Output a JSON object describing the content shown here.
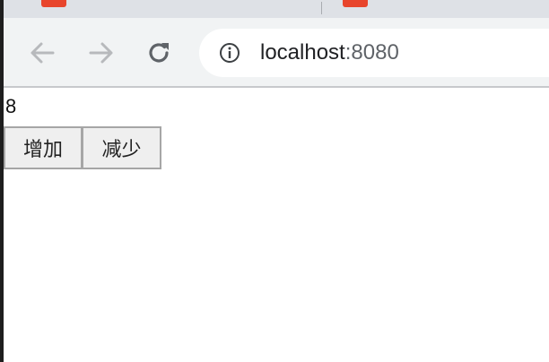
{
  "browser": {
    "address": {
      "host": "localhost",
      "port": ":8080"
    },
    "icons": {
      "back": "arrow-left-icon",
      "forward": "arrow-right-icon",
      "reload": "reload-icon",
      "info": "info-icon"
    },
    "colors": {
      "tab_favicon": "#e8452c",
      "toolbar": "#f1f3f4",
      "nav_icon_disabled": "#b7b9bc",
      "nav_icon_active": "#5f6368"
    }
  },
  "page": {
    "count": "8",
    "buttons": {
      "increase": "增加",
      "decrease": "减少"
    }
  }
}
